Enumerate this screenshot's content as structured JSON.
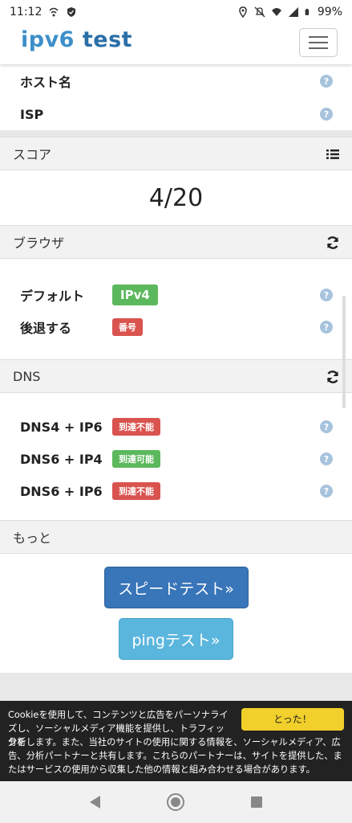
{
  "status_bar": {
    "time": "11:12",
    "battery": "99%",
    "icons": [
      "wifi-call-icon",
      "shield-icon",
      "location-icon",
      "mute-icon",
      "wifi-icon",
      "signal-icon",
      "battery-icon"
    ]
  },
  "header": {
    "logo_part1": "ipv6",
    "logo_part2": " test",
    "menu_icon": "hamburger-icon"
  },
  "top_rows": [
    {
      "label": "ホスト名"
    },
    {
      "label": "ISP"
    }
  ],
  "score_section": {
    "title": "スコア",
    "icon": "list-icon",
    "value": "4/20"
  },
  "browser_section": {
    "title": "ブラウザ",
    "icon": "refresh-icon",
    "rows": [
      {
        "label": "デフォルト",
        "badge": "IPv4",
        "color": "#5cb85c"
      },
      {
        "label": "後退する",
        "badge": "番号",
        "color": "#d9534f"
      }
    ]
  },
  "dns_section": {
    "title": "DNS",
    "icon": "refresh-icon",
    "rows": [
      {
        "label": "DNS4 + IP6",
        "badge": "到達不能",
        "color": "#d9534f"
      },
      {
        "label": "DNS6 + IP4",
        "badge": "到達可能",
        "color": "#5cb85c"
      },
      {
        "label": "DNS6 + IP6",
        "badge": "到達不能",
        "color": "#d9534f"
      }
    ]
  },
  "more_section": {
    "title": "もっと",
    "speed_button": "スピードテスト»",
    "ping_button": "pingテスト»"
  },
  "cookie_bar": {
    "text_short": "Cookieを使用して、コンテンツと広告をパーソナライズし、ソーシャルメディア機能を提供し、トラフィックを",
    "text_full": "分析します。また、当社のサイトの使用に関する情報を、ソーシャルメディア、広告、分析パートナーと共有します。これらのパートナーは、サイトを提供した、またはサービスの使用から収集した他の情報と組み合わせる場合があります。",
    "accept_button": "とった！"
  },
  "help_glyph": "?"
}
